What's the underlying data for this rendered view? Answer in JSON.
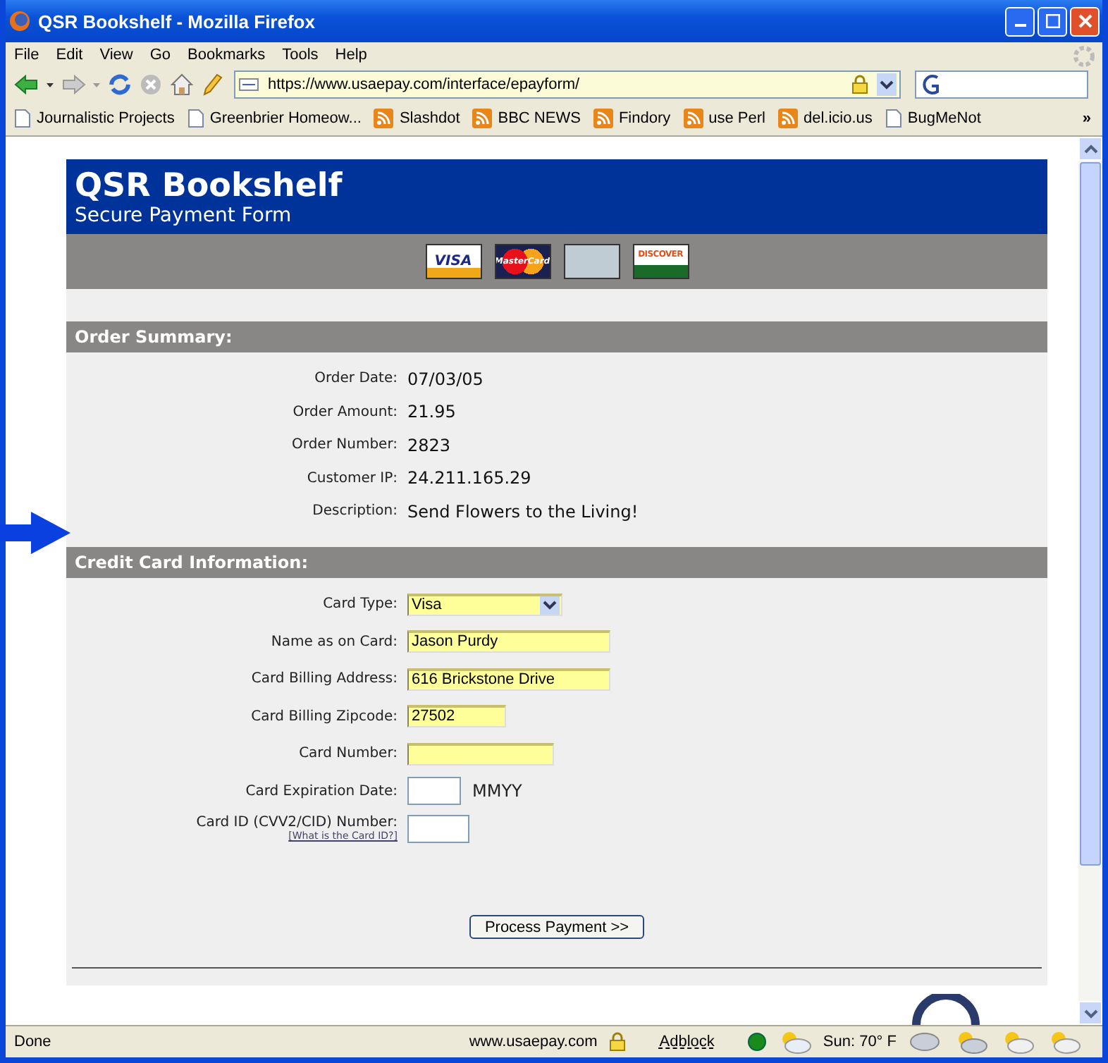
{
  "window": {
    "title": "QSR Bookshelf - Mozilla Firefox"
  },
  "menu": [
    "File",
    "Edit",
    "View",
    "Go",
    "Bookmarks",
    "Tools",
    "Help"
  ],
  "address": {
    "url": "https://www.usaepay.com/interface/epayform/"
  },
  "bookmarks": [
    {
      "kind": "page",
      "label": "Journalistic Projects"
    },
    {
      "kind": "page",
      "label": "Greenbrier Homeow..."
    },
    {
      "kind": "feed",
      "label": "Slashdot"
    },
    {
      "kind": "feed",
      "label": "BBC NEWS"
    },
    {
      "kind": "feed",
      "label": "Findory"
    },
    {
      "kind": "feed",
      "label": "use Perl"
    },
    {
      "kind": "feed",
      "label": "del.icio.us"
    },
    {
      "kind": "page",
      "label": "BugMeNot"
    }
  ],
  "bookmarks_more": "»",
  "page": {
    "title": "QSR Bookshelf",
    "subtitle": "Secure Payment Form",
    "cards": [
      {
        "kind": "visa",
        "label": "VISA"
      },
      {
        "kind": "mastercard",
        "label": "MasterCard"
      },
      {
        "kind": "amex"
      },
      {
        "kind": "discover",
        "label": "DISCOVER"
      }
    ],
    "order_summary": {
      "heading": "Order Summary:",
      "rows": [
        {
          "label": "Order Date:",
          "value": "07/03/05"
        },
        {
          "label": "Order Amount:",
          "value": "21.95"
        },
        {
          "label": "Order Number:",
          "value": "2823"
        },
        {
          "label": "Customer IP:",
          "value": "24.211.165.29"
        },
        {
          "label": "Description:",
          "value": "Send Flowers to the Living!"
        }
      ]
    },
    "credit_card": {
      "heading": "Credit Card Information:",
      "fields": [
        {
          "kind": "select",
          "label": "Card Type:",
          "value": "Visa",
          "highlighted": true
        },
        {
          "kind": "text",
          "label": "Name as on Card:",
          "value": "Jason Purdy",
          "highlighted": true
        },
        {
          "kind": "text",
          "label": "Card Billing Address:",
          "value": "616 Brickstone Drive",
          "highlighted": true
        },
        {
          "kind": "text",
          "label": "Card Billing Zipcode:",
          "value": "27502",
          "highlighted": true
        },
        {
          "kind": "text",
          "label": "Card Number:",
          "highlighted": true
        },
        {
          "kind": "text",
          "label": "Card Expiration Date:",
          "highlighted": false,
          "suffix": "MMYY"
        },
        {
          "kind": "text",
          "label": "Card ID (CVV2/CID) Number:",
          "highlighted": false,
          "link": "[What is the Card ID?]"
        }
      ]
    },
    "submit": "Process Payment >>"
  },
  "status_bar": {
    "status": "Done",
    "site": "www.usaepay.com",
    "adblock": "Adblock",
    "weather": "Sun: 70° F"
  }
}
